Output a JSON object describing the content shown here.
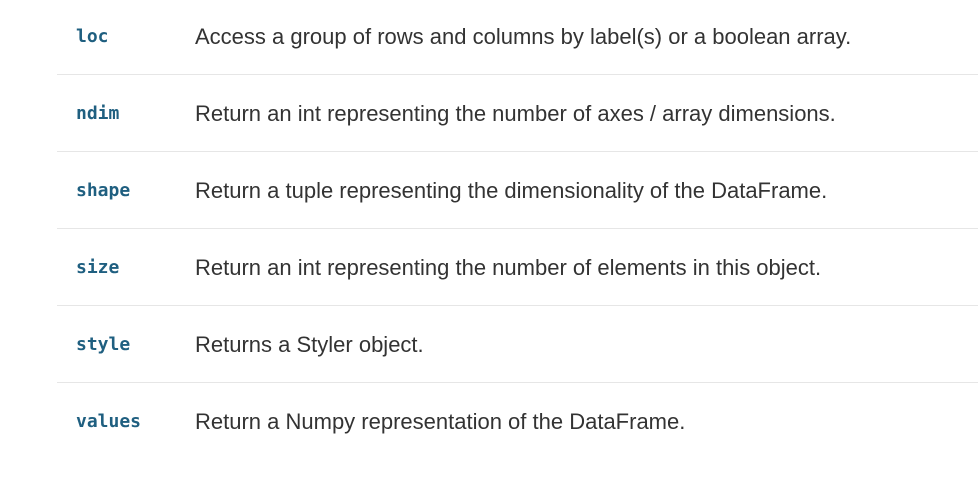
{
  "attributes": [
    {
      "name": "loc",
      "description": "Access a group of rows and columns by label(s) or a boolean array."
    },
    {
      "name": "ndim",
      "description": "Return an int representing the number of axes / array dimensions."
    },
    {
      "name": "shape",
      "description": "Return a tuple representing the dimensionality of the DataFrame."
    },
    {
      "name": "size",
      "description": "Return an int representing the number of elements in this object."
    },
    {
      "name": "style",
      "description": "Returns a Styler object."
    },
    {
      "name": "values",
      "description": "Return a Numpy representation of the DataFrame."
    }
  ]
}
